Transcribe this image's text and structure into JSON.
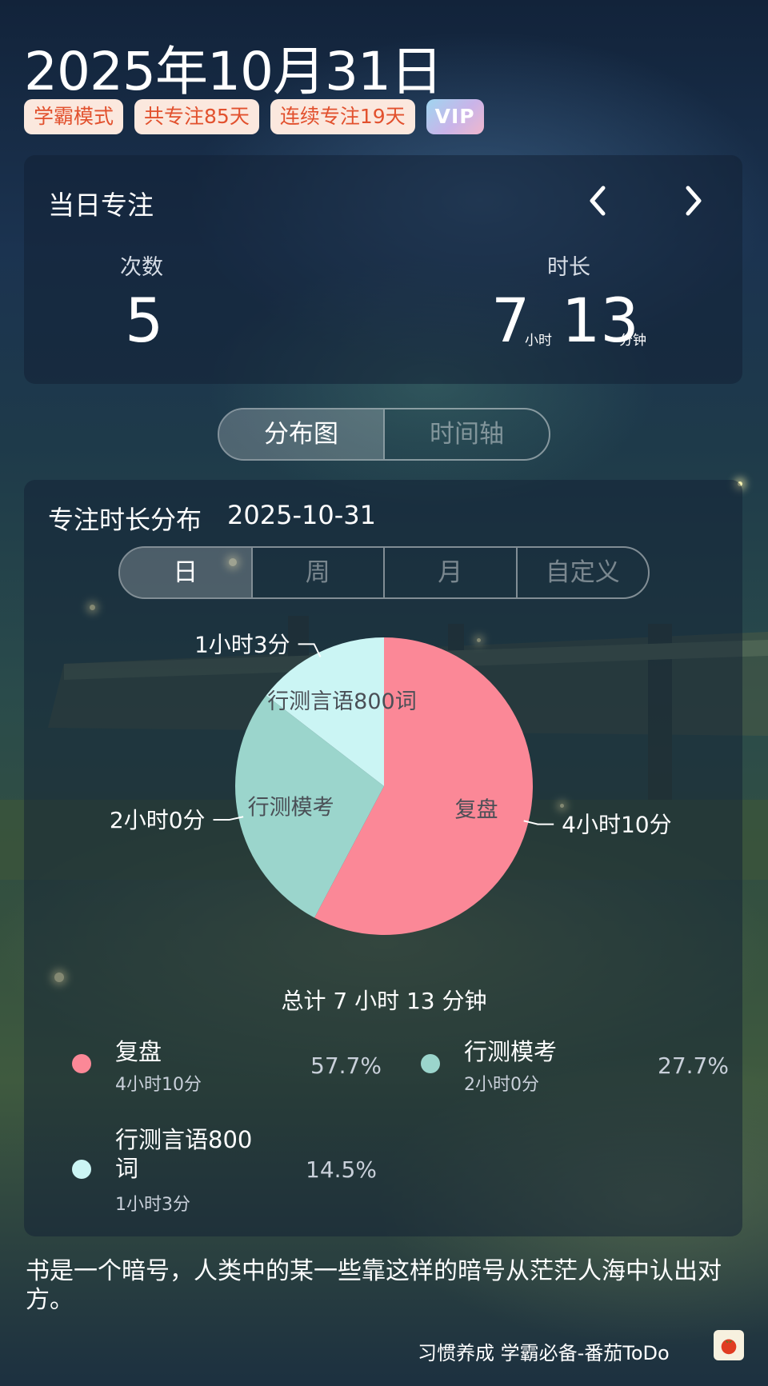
{
  "header": {
    "date": "2025年10月31日",
    "badges": [
      "学霸模式",
      "共专注85天",
      "连续专注19天",
      "VIP"
    ]
  },
  "daily": {
    "title": "当日专注",
    "count_label": "次数",
    "count_value": "5",
    "duration_label": "时长",
    "hours": "7",
    "hours_unit": "小时",
    "minutes": "13",
    "minutes_unit": "分钟",
    "prev_icon": "chevron-left-icon",
    "next_icon": "chevron-right-icon"
  },
  "view_tabs": [
    {
      "label": "分布图",
      "active": true
    },
    {
      "label": "时间轴",
      "active": false
    }
  ],
  "distribution": {
    "title": "专注时长分布",
    "date": "2025-10-31",
    "period_tabs": [
      {
        "label": "日",
        "active": true
      },
      {
        "label": "周",
        "active": false
      },
      {
        "label": "月",
        "active": false
      },
      {
        "label": "自定义",
        "active": false
      }
    ],
    "total_text": "总计 7 小时 13 分钟"
  },
  "chart_data": {
    "type": "pie",
    "categories": [
      "复盘",
      "行测模考",
      "行测言语800词"
    ],
    "values": [
      250,
      120,
      63
    ],
    "value_labels": [
      "4小时10分",
      "2小时0分",
      "1小时3分"
    ],
    "percentages": [
      "57.7%",
      "27.7%",
      "14.5%"
    ],
    "colors": [
      "#fb8897",
      "#9bd5cc",
      "#cbf5f4"
    ]
  },
  "legend": [
    {
      "name": "复盘",
      "time": "4小时10分",
      "pct": "57.7%",
      "color": "#fb8897"
    },
    {
      "name": "行测模考",
      "time": "2小时0分",
      "pct": "27.7%",
      "color": "#9bd5cc"
    },
    {
      "name": "行测言语800词",
      "name_line1": "行测言语800",
      "name_line2": "词",
      "time": "1小时3分",
      "pct": "14.5%",
      "color": "#cbf5f4"
    }
  ],
  "quote": "书是一个暗号，人类中的某一些靠这样的暗号从茫茫人海中认出对方。",
  "footer": {
    "text": "习惯养成 学霸必备-番茄ToDo",
    "icon": "tomato-icon"
  }
}
